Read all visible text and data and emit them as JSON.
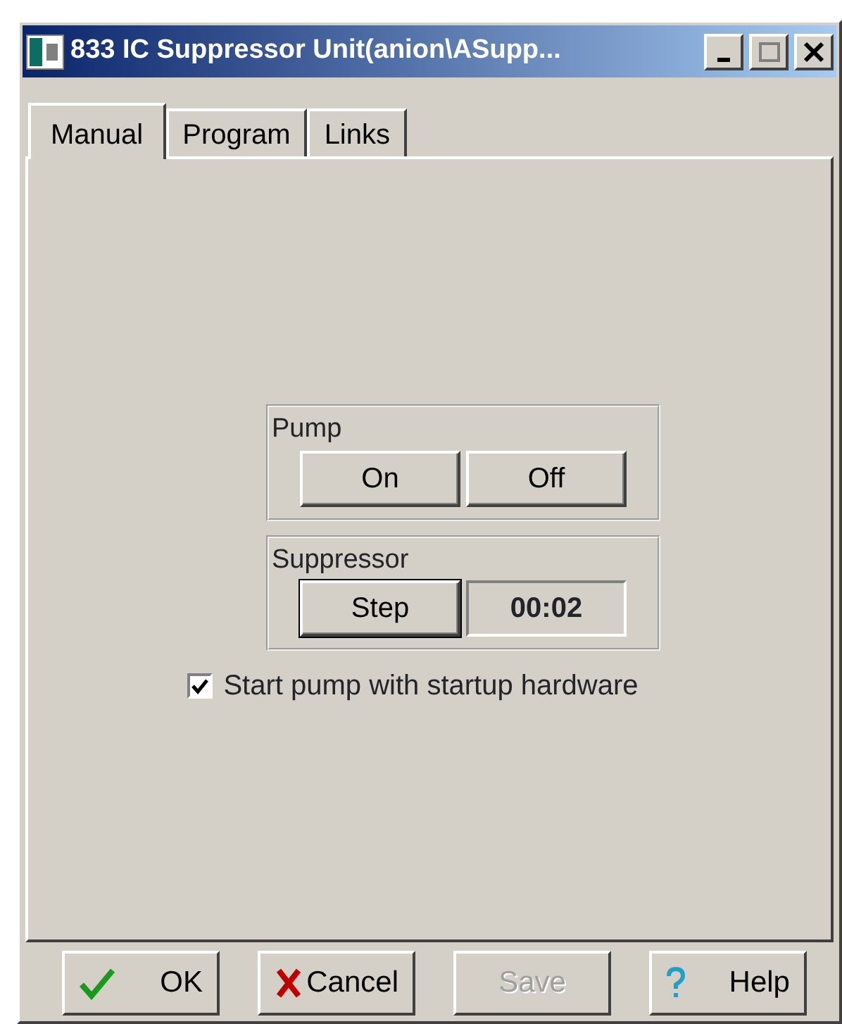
{
  "window": {
    "title": "833 IC Suppressor Unit(anion\\ASupp..."
  },
  "tabs": [
    {
      "label": "Manual",
      "selected": true
    },
    {
      "label": "Program",
      "selected": false
    },
    {
      "label": "Links",
      "selected": false
    }
  ],
  "pump": {
    "label": "Pump",
    "buttons": [
      {
        "label": "On",
        "focused": false
      },
      {
        "label": "Off",
        "focused": false
      }
    ]
  },
  "suppressor": {
    "label": "Suppressor",
    "button": {
      "label": "Step",
      "focused": true
    },
    "timer": "00:02"
  },
  "startup_checkbox": {
    "label": "Start pump with startup hardware",
    "checked": true
  },
  "buttons": [
    {
      "label": "OK",
      "kind": "ok",
      "disabled": false
    },
    {
      "label": "Cancel",
      "kind": "cancel",
      "disabled": false
    },
    {
      "label": "Save",
      "kind": "plain",
      "disabled": true
    },
    {
      "label": "Help",
      "kind": "help",
      "disabled": false
    }
  ]
}
